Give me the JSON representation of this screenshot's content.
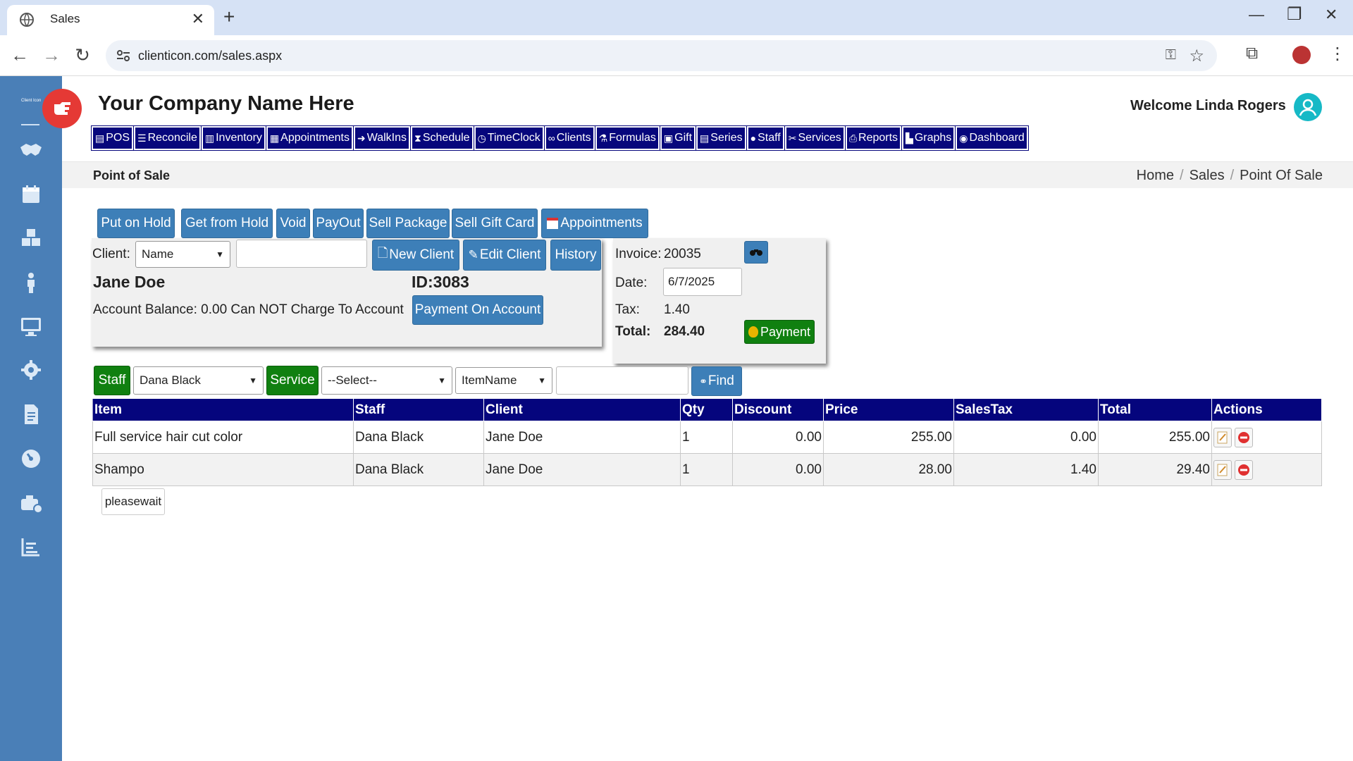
{
  "browser": {
    "tab_title": "Sales",
    "url": "clienticon.com/sales.aspx",
    "new_tab_symbol": "+",
    "close_symbol": "✕"
  },
  "sidebar": {
    "logo_text": "Client Icon",
    "items": [
      {
        "icon": "handshake-icon"
      },
      {
        "icon": "calendar-icon"
      },
      {
        "icon": "cubes-icon"
      },
      {
        "icon": "person-icon"
      },
      {
        "icon": "desktop-icon"
      },
      {
        "icon": "gear-icon"
      },
      {
        "icon": "document-icon"
      },
      {
        "icon": "dashboard-icon"
      },
      {
        "icon": "cash-register-icon"
      },
      {
        "icon": "bar-chart-icon"
      }
    ]
  },
  "header": {
    "company": "Your Company Name Here",
    "welcome": "Welcome Linda Rogers",
    "menu": [
      {
        "label": "POS",
        "glyph": "▤"
      },
      {
        "label": "Reconcile",
        "glyph": "☰"
      },
      {
        "label": "Inventory",
        "glyph": "▥"
      },
      {
        "label": "Appointments",
        "glyph": "▦"
      },
      {
        "label": "WalkIns",
        "glyph": "➜"
      },
      {
        "label": "Schedule",
        "glyph": "⧗"
      },
      {
        "label": "TimeClock",
        "glyph": "◷"
      },
      {
        "label": "Clients",
        "glyph": "∞"
      },
      {
        "label": "Formulas",
        "glyph": "⚗"
      },
      {
        "label": "Gift",
        "glyph": "▣"
      },
      {
        "label": "Series",
        "glyph": "▤"
      },
      {
        "label": "Staff",
        "glyph": "●"
      },
      {
        "label": "Services",
        "glyph": "✂"
      },
      {
        "label": "Reports",
        "glyph": "⎙"
      },
      {
        "label": "Graphs",
        "glyph": "▙"
      },
      {
        "label": "Dashboard",
        "glyph": "◉"
      }
    ]
  },
  "page": {
    "title": "Point of Sale",
    "breadcrumb": [
      "Home",
      "Sales",
      "Point Of Sale"
    ]
  },
  "actions": {
    "put_on_hold": "Put on Hold",
    "get_from_hold": "Get from Hold",
    "void": "Void",
    "payout": "PayOut",
    "sell_package": "Sell Package",
    "sell_gift_card": "Sell Gift Card",
    "appointments": "Appointments"
  },
  "client": {
    "label": "Client:",
    "search_by": "Name",
    "search_value": "",
    "new_client": "New Client",
    "edit_client": "Edit Client",
    "history": "History",
    "name": "Jane Doe",
    "id": "ID:3083",
    "account_balance": "Account Balance: 0.00 Can NOT Charge To Account",
    "payment_on_account": "Payment On Account"
  },
  "invoice": {
    "invoice_label": "Invoice:",
    "invoice_number": "20035",
    "date_label": "Date:",
    "date": "6/7/2025",
    "tax_label": "Tax:",
    "tax": "1.40",
    "total_label": "Total:",
    "total": "284.40",
    "payment": "Payment"
  },
  "filters": {
    "staff_label": "Staff",
    "staff_value": "Dana Black",
    "service_label": "Service",
    "service_value": "--Select--",
    "item_field": "ItemName",
    "item_search": "",
    "find": "Find"
  },
  "table": {
    "headers": [
      "Item",
      "Staff",
      "Client",
      "Qty",
      "Discount",
      "Price",
      "SalesTax",
      "Total",
      "Actions"
    ],
    "rows": [
      {
        "item": "Full service hair cut color",
        "staff": "Dana Black",
        "client": "Jane Doe",
        "qty": "1",
        "discount": "0.00",
        "price": "255.00",
        "salestax": "0.00",
        "total": "255.00"
      },
      {
        "item": "Shampo",
        "staff": "Dana Black",
        "client": "Jane Doe",
        "qty": "1",
        "discount": "0.00",
        "price": "28.00",
        "salestax": "1.40",
        "total": "29.40"
      }
    ]
  },
  "status": {
    "pleasewait": "pleasewait"
  },
  "colors": {
    "sidebar": "#4a7fb7",
    "menu_bg": "#07077c",
    "button_blue": "#3d7fb8",
    "button_green": "#108010",
    "table_header": "#05057d",
    "brand_red": "#e53935"
  }
}
